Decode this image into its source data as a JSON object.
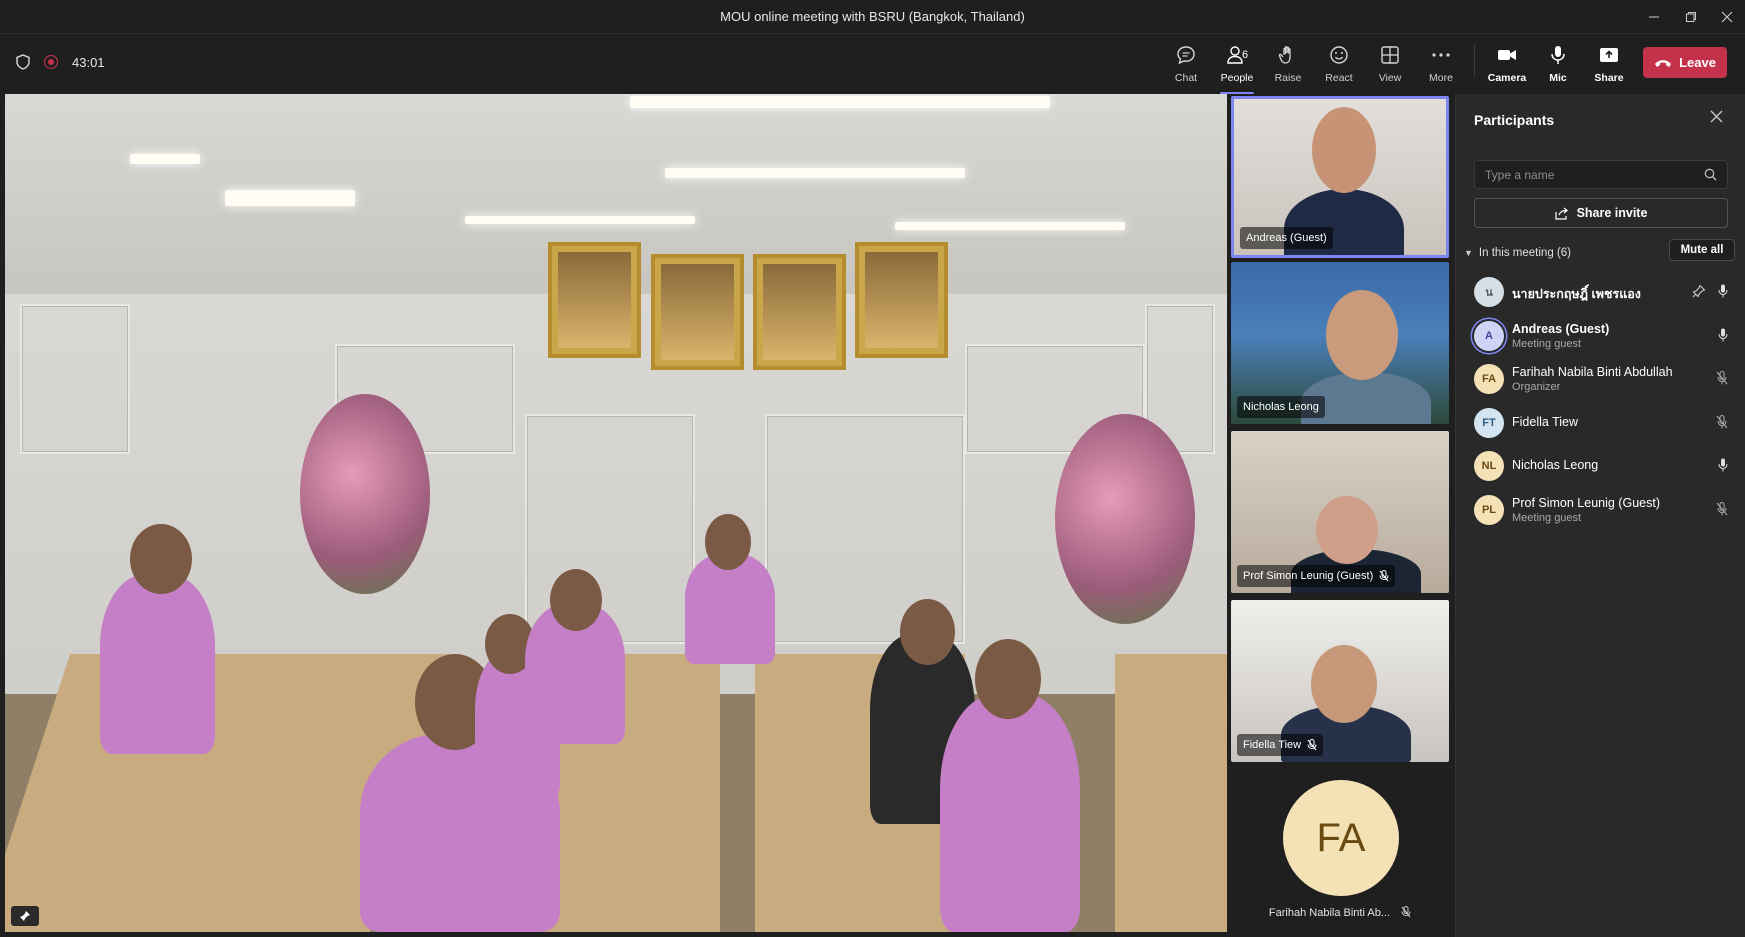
{
  "window": {
    "title": "MOU online meeting with BSRU (Bangkok, Thailand)"
  },
  "meeting": {
    "timer": "43:01"
  },
  "toolbar": {
    "chat": "Chat",
    "people": "People",
    "people_count": "6",
    "raise": "Raise",
    "react": "React",
    "view": "View",
    "more": "More",
    "camera": "Camera",
    "mic": "Mic",
    "share": "Share",
    "leave": "Leave"
  },
  "tiles": [
    {
      "name": "Andreas (Guest)"
    },
    {
      "name": "Nicholas Leong"
    },
    {
      "name": "Prof Simon Leunig (Guest)"
    },
    {
      "name": "Fidella Tiew"
    },
    {
      "name": "Farihah Nabila Binti Ab...",
      "initials": "FA"
    }
  ],
  "participants_panel": {
    "title": "Participants",
    "search_placeholder": "Type a name",
    "share_invite": "Share invite",
    "section_label": "In this meeting (6)",
    "mute_all": "Mute all",
    "people": [
      {
        "initials": "น",
        "name": "นายประกฤษฎิ์ เพชรแอง",
        "role": "",
        "avatar_bg": "#d6dfe6",
        "avatar_fg": "#51606b"
      },
      {
        "initials": "A",
        "name": "Andreas (Guest)",
        "role": "Meeting guest",
        "avatar_bg": "#cfd3f5",
        "avatar_fg": "#3d4597"
      },
      {
        "initials": "FA",
        "name": "Farihah Nabila Binti Abdullah",
        "role": "Organizer",
        "avatar_bg": "#f4e2b6",
        "avatar_fg": "#6b4a12"
      },
      {
        "initials": "FT",
        "name": "Fidella Tiew",
        "role": "",
        "avatar_bg": "#d3e5f1",
        "avatar_fg": "#2d5c7d"
      },
      {
        "initials": "NL",
        "name": "Nicholas Leong",
        "role": "",
        "avatar_bg": "#f4e2b6",
        "avatar_fg": "#6b4a12"
      },
      {
        "initials": "PL",
        "name": "Prof Simon Leunig (Guest)",
        "role": "Meeting guest",
        "avatar_bg": "#f4e2b6",
        "avatar_fg": "#6b4a12"
      }
    ]
  },
  "colors": {
    "accent": "#7f85f5",
    "leave": "#c4314b",
    "panel_bg": "#292929",
    "chrome_bg": "#1f1f1f"
  }
}
